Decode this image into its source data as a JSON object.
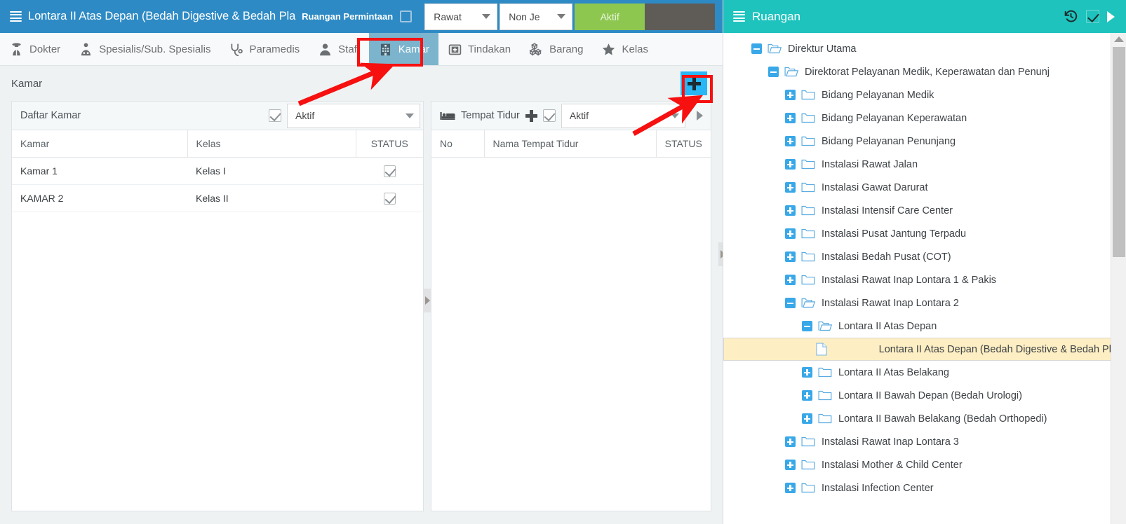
{
  "titlebar": {
    "menu_icon": "hamburger-icon",
    "title": "Lontara II Atas Depan (Bedah Digestive & Bedah Pla",
    "subtitle": "Ruangan Permintaan",
    "checkbox_checked": false,
    "select_rawat": "Rawat",
    "select_nonjenis": "Non Je",
    "button_aktif": "Aktif",
    "button_dark": "",
    "bg_color": "#2e8ac4",
    "aktif_color": "#8dc750"
  },
  "toolbar": {
    "items": [
      {
        "label": "Dokter",
        "icon": "doctor-icon",
        "active": false
      },
      {
        "label": "Spesialis/Sub. Spesialis",
        "icon": "specialist-icon",
        "active": false
      },
      {
        "label": "Paramedis",
        "icon": "stethoscope-icon",
        "active": false
      },
      {
        "label": "Staff",
        "icon": "user-icon",
        "active": false
      },
      {
        "label": "Kamar",
        "icon": "building-icon",
        "active": true
      },
      {
        "label": "Tindakan",
        "icon": "medical-kit-icon",
        "active": false
      },
      {
        "label": "Barang",
        "icon": "boxes-icon",
        "active": false
      },
      {
        "label": "Kelas",
        "icon": "star-icon",
        "active": false
      }
    ],
    "active_bg": "#7cb4cd"
  },
  "section": {
    "title": "Kamar",
    "add_button_icon": "plus-icon",
    "add_button_color": "#29b6f6"
  },
  "kamar_panel": {
    "header_title": "Daftar Kamar",
    "header_checkbox_checked": true,
    "filter_value": "Aktif",
    "columns": [
      "Kamar",
      "Kelas",
      "STATUS"
    ],
    "rows": [
      {
        "kamar": "Kamar 1",
        "kelas": "Kelas I",
        "status": true
      },
      {
        "kamar": "KAMAR 2",
        "kelas": "Kelas II",
        "status": true
      }
    ]
  },
  "tempat_tidur_panel": {
    "header_title": "Tempat Tidur",
    "header_icon": "bed-icon",
    "add_icon": "plus-icon",
    "header_checkbox_checked": true,
    "filter_value": "Aktif",
    "next_icon": "chevron-right-icon",
    "columns": [
      "No",
      "Nama Tempat Tidur",
      "STATUS"
    ],
    "rows": []
  },
  "tree_panel": {
    "header_title": "Ruangan",
    "header_menu_icon": "hamburger-icon",
    "header_icons": [
      "history-icon",
      "checkbox-icon",
      "play-icon"
    ],
    "header_color": "#1ec3bd",
    "nodes": [
      {
        "label": "Direktur Utama",
        "depth": 0,
        "toggle": "minus",
        "icon": "folder-open-icon",
        "selected": false
      },
      {
        "label": "Direktorat Pelayanan Medik, Keperawatan dan Penunj",
        "depth": 1,
        "toggle": "minus",
        "icon": "folder-open-icon",
        "selected": false
      },
      {
        "label": "Bidang Pelayanan Medik",
        "depth": 2,
        "toggle": "plus",
        "icon": "folder-icon",
        "selected": false
      },
      {
        "label": "Bidang Pelayanan Keperawatan",
        "depth": 2,
        "toggle": "plus",
        "icon": "folder-icon",
        "selected": false
      },
      {
        "label": "Bidang Pelayanan Penunjang",
        "depth": 2,
        "toggle": "plus",
        "icon": "folder-icon",
        "selected": false
      },
      {
        "label": "Instalasi Rawat Jalan",
        "depth": 2,
        "toggle": "plus",
        "icon": "folder-icon",
        "selected": false
      },
      {
        "label": "Instalasi Gawat Darurat",
        "depth": 2,
        "toggle": "plus",
        "icon": "folder-icon",
        "selected": false
      },
      {
        "label": "Instalasi Intensif Care Center",
        "depth": 2,
        "toggle": "plus",
        "icon": "folder-icon",
        "selected": false
      },
      {
        "label": "Instalasi Pusat Jantung Terpadu",
        "depth": 2,
        "toggle": "plus",
        "icon": "folder-icon",
        "selected": false
      },
      {
        "label": "Instalasi Bedah Pusat (COT)",
        "depth": 2,
        "toggle": "plus",
        "icon": "folder-icon",
        "selected": false
      },
      {
        "label": "Instalasi Rawat Inap Lontara 1 & Pakis",
        "depth": 2,
        "toggle": "plus",
        "icon": "folder-icon",
        "selected": false
      },
      {
        "label": "Instalasi Rawat Inap Lontara 2",
        "depth": 2,
        "toggle": "minus",
        "icon": "folder-open-icon",
        "selected": false
      },
      {
        "label": "Lontara II Atas Depan",
        "depth": 3,
        "toggle": "minus",
        "icon": "folder-open-icon",
        "selected": false
      },
      {
        "label": "Lontara II Atas Depan (Bedah Digestive & Bedah Pla",
        "depth": 4,
        "toggle": "none",
        "icon": "document-icon",
        "selected": true
      },
      {
        "label": "Lontara II Atas Belakang",
        "depth": 3,
        "toggle": "plus",
        "icon": "folder-icon",
        "selected": false
      },
      {
        "label": "Lontara II Bawah Depan (Bedah Urologi)",
        "depth": 3,
        "toggle": "plus",
        "icon": "folder-icon",
        "selected": false
      },
      {
        "label": "Lontara II Bawah Belakang (Bedah Orthopedi)",
        "depth": 3,
        "toggle": "plus",
        "icon": "folder-icon",
        "selected": false
      },
      {
        "label": "Instalasi Rawat Inap Lontara 3",
        "depth": 2,
        "toggle": "plus",
        "icon": "folder-icon",
        "selected": false
      },
      {
        "label": "Instalasi Mother & Child Center",
        "depth": 2,
        "toggle": "plus",
        "icon": "folder-icon",
        "selected": false
      },
      {
        "label": "Instalasi Infection Center",
        "depth": 2,
        "toggle": "plus",
        "icon": "folder-icon",
        "selected": false
      }
    ],
    "selected_row_color": "#fdeec3"
  },
  "annotations": {
    "highlight_color": "#f61010",
    "arrow_color": "#f61010",
    "boxes": [
      "kamar-tab-highlight",
      "add-button-highlight"
    ],
    "arrows": [
      "arrow-to-kamar-tab",
      "arrow-to-add-button",
      "arrow-to-tempat-tidur-filter"
    ]
  }
}
